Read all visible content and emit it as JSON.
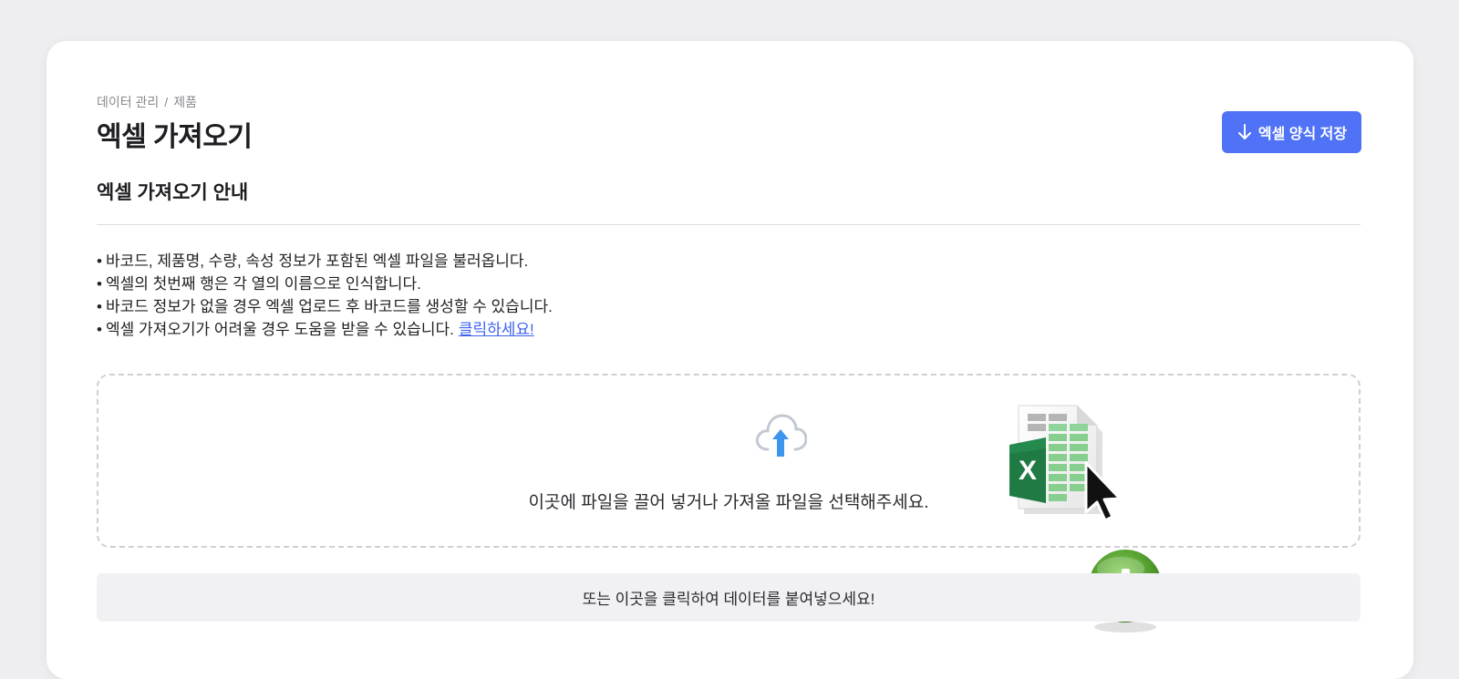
{
  "breadcrumb": {
    "parent": "데이터 관리",
    "separator": "/",
    "current": "제품"
  },
  "page_title": "엑셀 가져오기",
  "save_template_button": {
    "label": "엑셀 양식 저장",
    "icon": "arrow-down-icon",
    "color": "#4f72f6"
  },
  "guide": {
    "title": "엑셀 가져오기 안내",
    "bullet": "•",
    "items": [
      "바코드, 제품명, 수량, 속성 정보가 포함된 엑셀 파일을 불러옵니다.",
      "엑셀의 첫번째 행은 각 열의 이름으로 인식합니다.",
      "바코드 정보가 없을 경우 엑셀 업로드 후 바코드를 생성할 수 있습니다.",
      "엑셀 가져오기가 어려울 경우 도움을 받을 수 있습니다."
    ],
    "help_link": "클릭하세요!"
  },
  "dropzone": {
    "icon": "cloud-upload-icon",
    "text": "이곳에 파일을 끌어 넣거나 가져올 파일을 선택해주세요.",
    "graphic": "excel-file-drag-icon",
    "graphic_letter": "X"
  },
  "paste_bar": {
    "text": "또는 이곳을 클릭하여 데이터를 붙여넣으세요!"
  }
}
